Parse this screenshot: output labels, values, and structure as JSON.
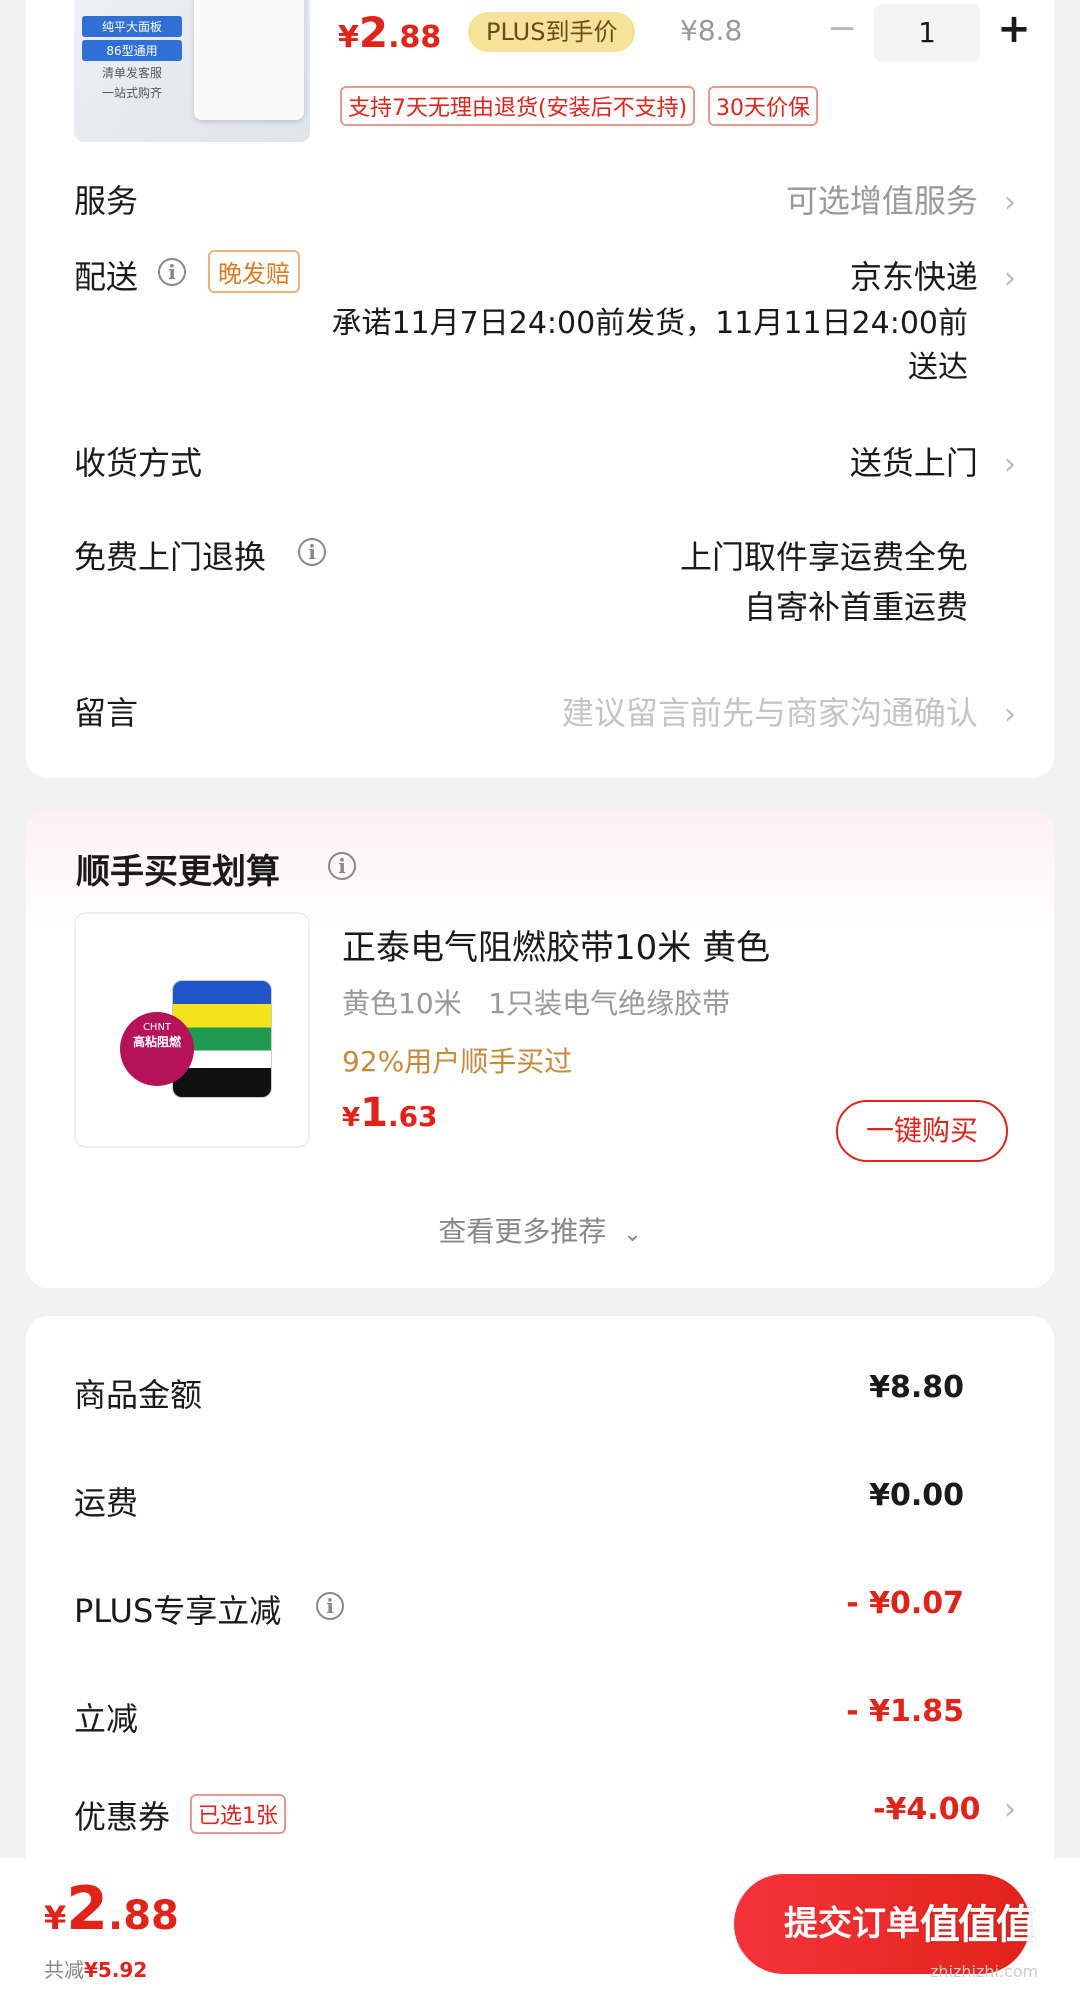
{
  "product": {
    "image_texts": [
      "纯平大面板",
      "86型通用",
      "清单发客服",
      "一站式购齐"
    ],
    "price_symbol": "¥",
    "price_int": "2",
    "price_dec": ".88",
    "plus_badge": "PLUS到手价",
    "original_price": "¥8.8",
    "quantity": "1",
    "minus_label": "−",
    "plus_label": "+",
    "tag_return": "支持7天无理由退货(安装后不支持)",
    "tag_price_protect": "30天价保"
  },
  "service": {
    "label": "服务",
    "value": "可选增值服务"
  },
  "delivery": {
    "label": "配送",
    "badge": "晚发赔",
    "carrier": "京东快递",
    "promise_line1": "承诺11月7日24:00前发货，11月11日24:00前",
    "promise_line2": "送达"
  },
  "receive": {
    "label": "收货方式",
    "value": "送货上门"
  },
  "free_return": {
    "label": "免费上门退换",
    "line1": "上门取件享运费全免",
    "line2": "自寄补首重运费"
  },
  "message": {
    "label": "留言",
    "placeholder": "建议留言前先与商家沟通确认"
  },
  "recommend": {
    "title": "顺手买更划算",
    "item_image_text": "高粘阻燃",
    "item_brand": "CHNT",
    "item_name": "正泰电气阻燃胶带10米 黄色",
    "item_spec": "黄色10米   1只装电气绝缘胶带",
    "item_social": "92%用户顺手买过",
    "item_price_symbol": "¥",
    "item_price_int": "1",
    "item_price_dec": ".63",
    "buy_button": "一键购买",
    "more": "查看更多推荐"
  },
  "summary": {
    "rows": [
      {
        "label": "商品金额",
        "value": "¥8.80"
      },
      {
        "label": "运费",
        "value": "¥0.00"
      },
      {
        "label": "PLUS专享立减",
        "value": "- ¥0.07"
      },
      {
        "label": "立减",
        "value": "- ¥1.85"
      },
      {
        "label": "优惠券",
        "badge": "已选1张",
        "value": "-¥4.00"
      }
    ]
  },
  "footer": {
    "total_symbol": "¥",
    "total_int": "2",
    "total_dec": ".88",
    "saved_label": "共减",
    "saved_value": "¥5.92",
    "submit": "提交订单",
    "watermark": "值值值",
    "watermark_url": "zhizhizhi.com"
  },
  "colors": {
    "accent": "#e2231a",
    "plus_gold": "#f7e29a",
    "orange": "#c68a3a"
  }
}
